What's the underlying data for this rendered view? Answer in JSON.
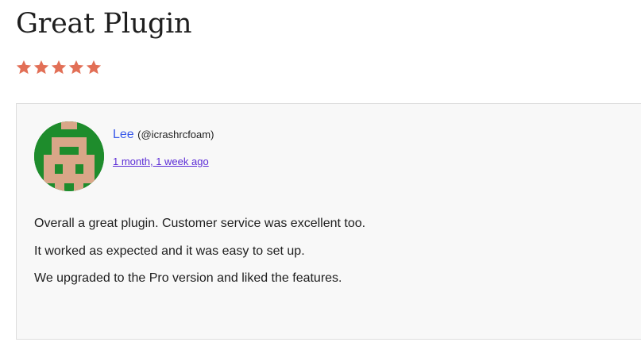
{
  "review": {
    "title": "Great Plugin",
    "rating": {
      "value": 5,
      "max": 5
    },
    "star_color": "#e26f56",
    "author": {
      "name": "Lee",
      "handle": "(@icrashrcfoam)",
      "avatar_colors": {
        "background": "#1e8c2c",
        "skin": "#d9a688"
      }
    },
    "date": "1 month, 1 week ago",
    "body": [
      "Overall a great plugin. Customer service was excellent too.",
      "It worked as expected and it was easy to set up.",
      "We upgraded to the Pro version and liked the features."
    ]
  },
  "colors": {
    "link": "#3858e9",
    "visited_link": "#5b2bd6",
    "card_background": "#f8f8f8"
  }
}
